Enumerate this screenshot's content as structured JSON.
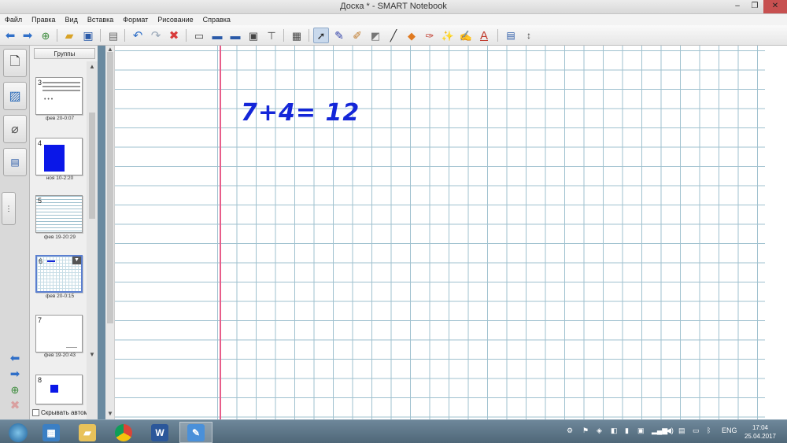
{
  "window": {
    "title": "Доска * - SMART Notebook",
    "min": "–",
    "max": "❐",
    "close": "✕"
  },
  "menu": [
    "Файл",
    "Правка",
    "Вид",
    "Вставка",
    "Формат",
    "Рисование",
    "Справка"
  ],
  "toolbar": {
    "icons": [
      "back-icon",
      "forward-icon",
      "add-page-icon",
      "open-icon",
      "save-icon",
      "paste-icon",
      "undo-icon",
      "redo-icon",
      "delete-icon",
      "screen-shade-icon",
      "full-screen-icon",
      "dual-page-icon",
      "screen-capture-icon",
      "document-camera-icon",
      "table-icon",
      "select-icon",
      "pen-icon",
      "creative-pen-icon",
      "eraser-icon",
      "line-icon",
      "shape-icon",
      "fill-icon",
      "magic-pen-icon",
      "shape-recognition-pen-icon",
      "text-icon",
      "properties-icon",
      "move-toolbar-icon"
    ],
    "selected": "select-icon"
  },
  "sorter": {
    "groups_label": "Группы",
    "pages": [
      {
        "num": "3",
        "label": "фев 20-0:07"
      },
      {
        "num": "4",
        "label": "ноя 10-2:20"
      },
      {
        "num": "5",
        "label": "фев 19-20:29"
      },
      {
        "num": "6",
        "label": "фев 20-0:15"
      },
      {
        "num": "7",
        "label": "фев 19-20:43"
      },
      {
        "num": "8",
        "label": ""
      }
    ],
    "autohide_label": "Скрывать автомат"
  },
  "canvas": {
    "equation": "7+4= 12"
  },
  "taskbar": {
    "apps": [
      "start-icon",
      "network-app-icon",
      "file-explorer-icon",
      "chrome-icon",
      "word-icon",
      "smart-notebook-icon"
    ],
    "lang": "ENG",
    "time": "17:04",
    "date": "25.04.2017"
  },
  "colors": {
    "ink": "#1426d8",
    "grid": "#9fc1cf",
    "margin": "#e85d8a",
    "taskbar": "#5a7386"
  }
}
